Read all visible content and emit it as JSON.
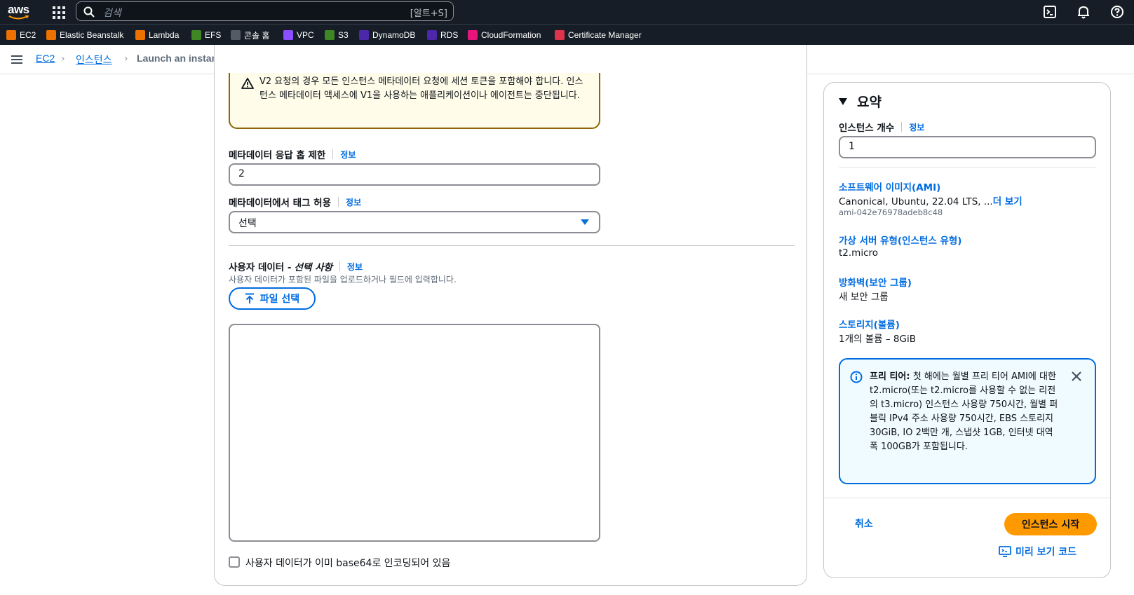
{
  "topnav": {
    "logo": "aws",
    "search_placeholder": "검색",
    "search_shortcut": "[알트+S]"
  },
  "favorites": [
    {
      "label": "EC2",
      "color": "#ed7100"
    },
    {
      "label": "Elastic Beanstalk",
      "color": "#ed7100"
    },
    {
      "label": "Lambda",
      "color": "#ed7100"
    },
    {
      "label": "EFS",
      "color": "#3f8624"
    },
    {
      "label": "콘솔 홈",
      "color": "#545b64"
    },
    {
      "label": "VPC",
      "color": "#8c4fff"
    },
    {
      "label": "S3",
      "color": "#3f8624"
    },
    {
      "label": "DynamoDB",
      "color": "#4d27aa"
    },
    {
      "label": "RDS",
      "color": "#4d27aa"
    },
    {
      "label": "CloudFormation",
      "color": "#e7157b"
    },
    {
      "label": "Certificate Manager",
      "color": "#dd344c"
    }
  ],
  "breadcrumb": {
    "items": [
      "EC2",
      "인스턴스"
    ],
    "current": "Launch an instance"
  },
  "main": {
    "warning_text": "V2 요청의 경우 모든 인스턴스 메타데이터 요청에 세션 토큰을 포함해야 합니다. 인스턴스 메타데이터 액세스에 V1을 사용하는 애플리케이션이나 에이전트는 중단됩니다.",
    "hop_limit": {
      "label": "메타데이터 응답 홉 제한",
      "info": "정보",
      "value": "2"
    },
    "tags_allow": {
      "label": "메타데이터에서 태그 허용",
      "info": "정보",
      "value": "선택"
    },
    "user_data": {
      "label": "사용자 데이터 -",
      "optional": "선택 사항",
      "info": "정보",
      "description": "사용자 데이터가 포함된 파일을 업로드하거나 필드에 입력합니다.",
      "file_button": "파일 선택",
      "value": "",
      "base64_checkbox": "사용자 데이터가 이미 base64로 인코딩되어 있음",
      "base64_checked": false
    }
  },
  "summary": {
    "title": "요약",
    "count_label": "인스턴스 개수",
    "count_info": "정보",
    "count_value": "1",
    "ami_link": "소프트웨어 이미지(AMI)",
    "ami_value": "Canonical, Ubuntu, 22.04 LTS, ...",
    "ami_more": "더 보기",
    "ami_id": "ami-042e76978adeb8c48",
    "type_link": "가상 서버 유형(인스턴스 유형)",
    "type_value": "t2.micro",
    "firewall_link": "방화벽(보안 그룹)",
    "firewall_value": "새 보안 그룹",
    "storage_link": "스토리지(볼륨)",
    "storage_value": "1개의 볼륨 – 8GiB",
    "free_tier_title": "프리 티어:",
    "free_tier_text": "첫 해에는 월별 프리 티어 AMI에 대한 t2.micro(또는 t2.micro를 사용할 수 없는 리전의 t3.micro) 인스턴스 사용량 750시간, 월별 퍼블릭 IPv4 주소 사용량 750시간, EBS 스토리지 30GiB, IO 2백만 개, 스냅샷 1GB, 인터넷 대역폭 100GB가 포함됩니다.",
    "cancel": "취소",
    "launch": "인스턴스 시작",
    "preview_code": "미리 보기 코드"
  }
}
